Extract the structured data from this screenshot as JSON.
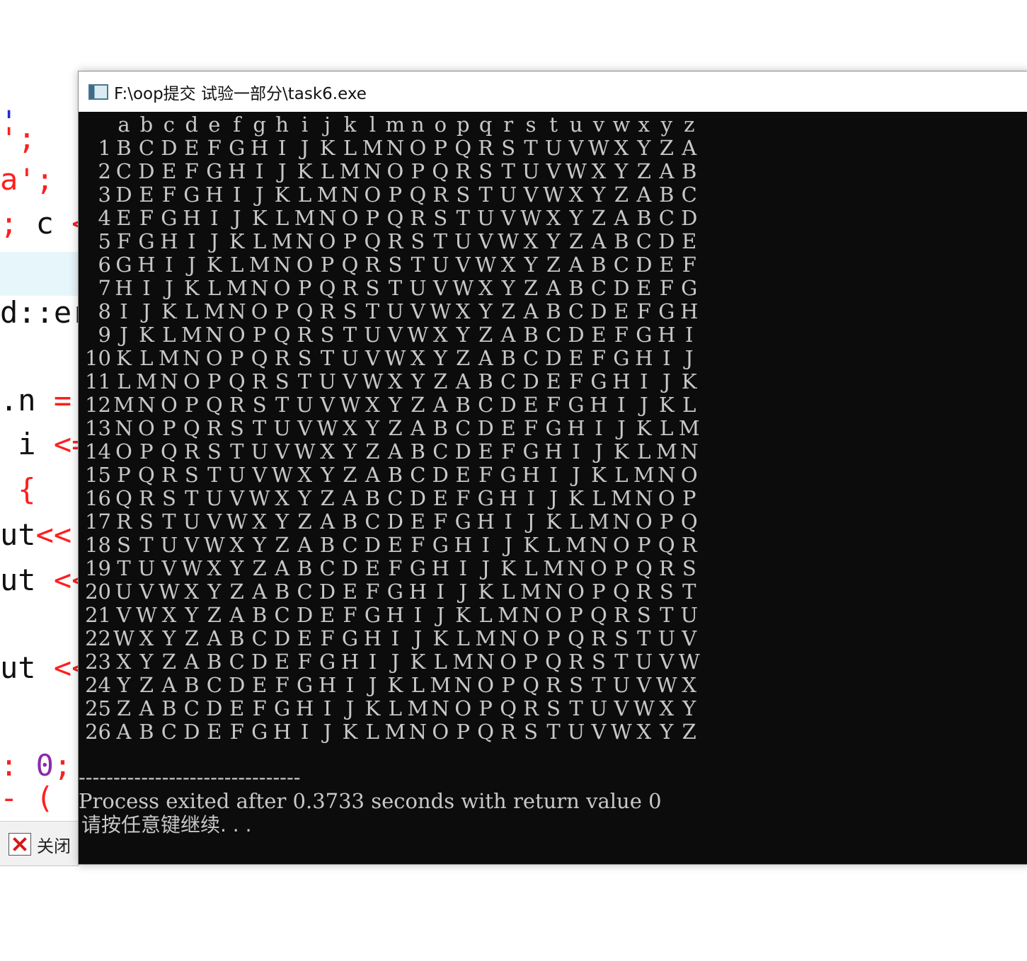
{
  "background_editor": {
    "lines": [
      [
        {
          "t": "'",
          "c": "blu"
        }
      ],
      [
        {
          "t": "';",
          "c": "red"
        }
      ],
      [
        {
          "t": "a'; ",
          "c": "red"
        },
        {
          "t": "(",
          "c": "red"
        }
      ],
      [
        {
          "t": "; ",
          "c": "red"
        },
        {
          "t": "c ",
          "c": "blk"
        },
        {
          "t": "<",
          "c": "red"
        }
      ],
      [
        {
          "t": "",
          "c": "blk"
        }
      ],
      [
        {
          "t": "d::er",
          "c": "blk"
        }
      ],
      [
        {
          "t": "",
          "c": "blk"
        }
      ],
      [
        {
          "t": ".n ",
          "c": "blk"
        },
        {
          "t": "=",
          "c": "red"
        }
      ],
      [
        {
          "t": " i ",
          "c": "blk"
        },
        {
          "t": "<=",
          "c": "red"
        }
      ],
      [
        {
          "t": " {",
          "c": "red"
        }
      ],
      [
        {
          "t": "ut",
          "c": "blk"
        },
        {
          "t": "<<'",
          "c": "red"
        }
      ],
      [
        {
          "t": "ut ",
          "c": "blk"
        },
        {
          "t": "<<",
          "c": "red"
        }
      ],
      [
        {
          "t": "",
          "c": "blk"
        }
      ],
      [
        {
          "t": "ut ",
          "c": "blk"
        },
        {
          "t": "<<",
          "c": "red"
        }
      ],
      [
        {
          "t": "",
          "c": "blk"
        }
      ],
      [
        {
          "t": ": ",
          "c": "red"
        },
        {
          "t": "0",
          "c": "pur"
        },
        {
          "t": ";",
          "c": "red"
        }
      ],
      [
        {
          "t": "- (",
          "c": "red"
        }
      ]
    ]
  },
  "ide_footer": {
    "close_label": "关闭"
  },
  "console": {
    "title": "F:\\oop提交 试验一部分\\task6.exe",
    "header_letters": [
      "a",
      "b",
      "c",
      "d",
      "e",
      "f",
      "g",
      "h",
      "i",
      "j",
      "k",
      "l",
      "m",
      "n",
      "o",
      "p",
      "q",
      "r",
      "s",
      "t",
      "u",
      "v",
      "w",
      "x",
      "y",
      "z"
    ],
    "rows": [
      {
        "num": "1",
        "text": "BCDEFGHIJKLMNOPQRSTUVWXYZA"
      },
      {
        "num": "2",
        "text": "CDEFGHIJKLMNOPQRSTUVWXYZAB"
      },
      {
        "num": "3",
        "text": "DEFGHIJKLMNOPQRSTUVWXYZABC"
      },
      {
        "num": "4",
        "text": "EFGHIJKLMNOPQRSTUVWXYZABCD"
      },
      {
        "num": "5",
        "text": "FGHIJKLMNOPQRSTUVWXYZABCDE"
      },
      {
        "num": "6",
        "text": "GHIJKLMNOPQRSTUVWXYZABCDEF"
      },
      {
        "num": "7",
        "text": "HIJKLMNOPQRSTUVWXYZABCDEFG"
      },
      {
        "num": "8",
        "text": "IJKLMNOPQRSTUVWXYZABCDEFGH"
      },
      {
        "num": "9",
        "text": "JKLMNOPQRSTUVWXYZABCDEFGHI"
      },
      {
        "num": "10",
        "text": "KLMNOPQRSTUVWXYZABCDEFGHIJ"
      },
      {
        "num": "11",
        "text": "LMNOPQRSTUVWXYZABCDEFGHIJK"
      },
      {
        "num": "12",
        "text": "MNOPQRSTUVWXYZABCDEFGHIJKL"
      },
      {
        "num": "13",
        "text": "NOPQRSTUVWXYZABCDEFGHIJKLM"
      },
      {
        "num": "14",
        "text": "OPQRSTUVWXYZABCDEFGHIJKLMN"
      },
      {
        "num": "15",
        "text": "PQRSTUVWXYZABCDEFGHIJKLMNO"
      },
      {
        "num": "16",
        "text": "QRSTUVWXYZABCDEFGHIJKLMNOP"
      },
      {
        "num": "17",
        "text": "RSTUVWXYZABCDEFGHIJKLMNOPQ"
      },
      {
        "num": "18",
        "text": "STUVWXYZABCDEFGHIJKLMNOPQR"
      },
      {
        "num": "19",
        "text": "TUVWXYZABCDEFGHIJKLMNOPQRS"
      },
      {
        "num": "20",
        "text": "UVWXYZABCDEFGHIJKLMNOPQRST"
      },
      {
        "num": "21",
        "text": "VWXYZABCDEFGHIJKLMNOPQRSTU"
      },
      {
        "num": "22",
        "text": "WXYZABCDEFGHIJKLMNOPQRSTUV"
      },
      {
        "num": "23",
        "text": "XYZABCDEFGHIJKLMNOPQRSTUVW"
      },
      {
        "num": "24",
        "text": "YZABCDEFGHIJKLMNOPQRSTUVWX"
      },
      {
        "num": "25",
        "text": "ZABCDEFGHIJKLMNOPQRSTUVWXY"
      },
      {
        "num": "26",
        "text": "ABCDEFGHIJKLMNOPQRSTUVWXYZ"
      }
    ],
    "separator": "--------------------------------",
    "process_message": "Process exited after 0.3733 seconds with return value 0",
    "press_key_message": "请按任意键继续. . ."
  },
  "colors": {
    "console_bg": "#0c0c0c",
    "console_text": "#c8c8c8",
    "code_red": "#ff1e1e",
    "code_purple": "#8b2aa8",
    "code_blue": "#1e2bdb",
    "editor_highlight": "#e6f6fb"
  },
  "icons": {
    "window_app_icon": "console-app-icon",
    "footer_close_icon": "close-icon"
  }
}
